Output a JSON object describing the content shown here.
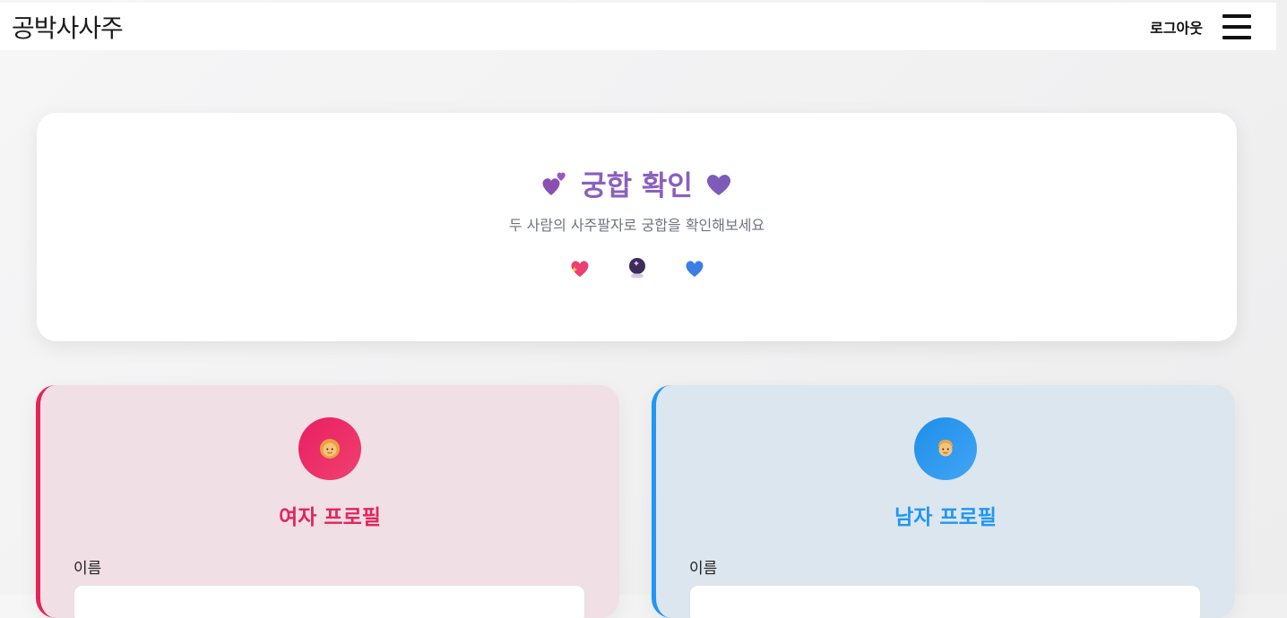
{
  "nav": {
    "brand": "공박사사주",
    "logout_label": "로그아웃"
  },
  "hero": {
    "title": "궁합 확인",
    "subtitle": "두 사람의 사주팔자로 궁합을 확인해보세요",
    "title_icons": [
      "two-hearts-icon",
      "purple-heart-icon"
    ],
    "icons": [
      "sparkling-heart-icon",
      "crystal-ball-icon",
      "blue-heart-icon"
    ]
  },
  "female": {
    "title": "여자 프로필",
    "name_label": "이름",
    "name_value": "",
    "icon": "woman-icon",
    "accent": "#e3245c"
  },
  "male": {
    "title": "남자 프로필",
    "name_label": "이름",
    "name_value": "",
    "icon": "man-icon",
    "accent": "#2196f3"
  },
  "colors": {
    "title_purple": "#8b5fbf",
    "female_bg": "#f0dfe5",
    "male_bg": "#dce6ee"
  }
}
